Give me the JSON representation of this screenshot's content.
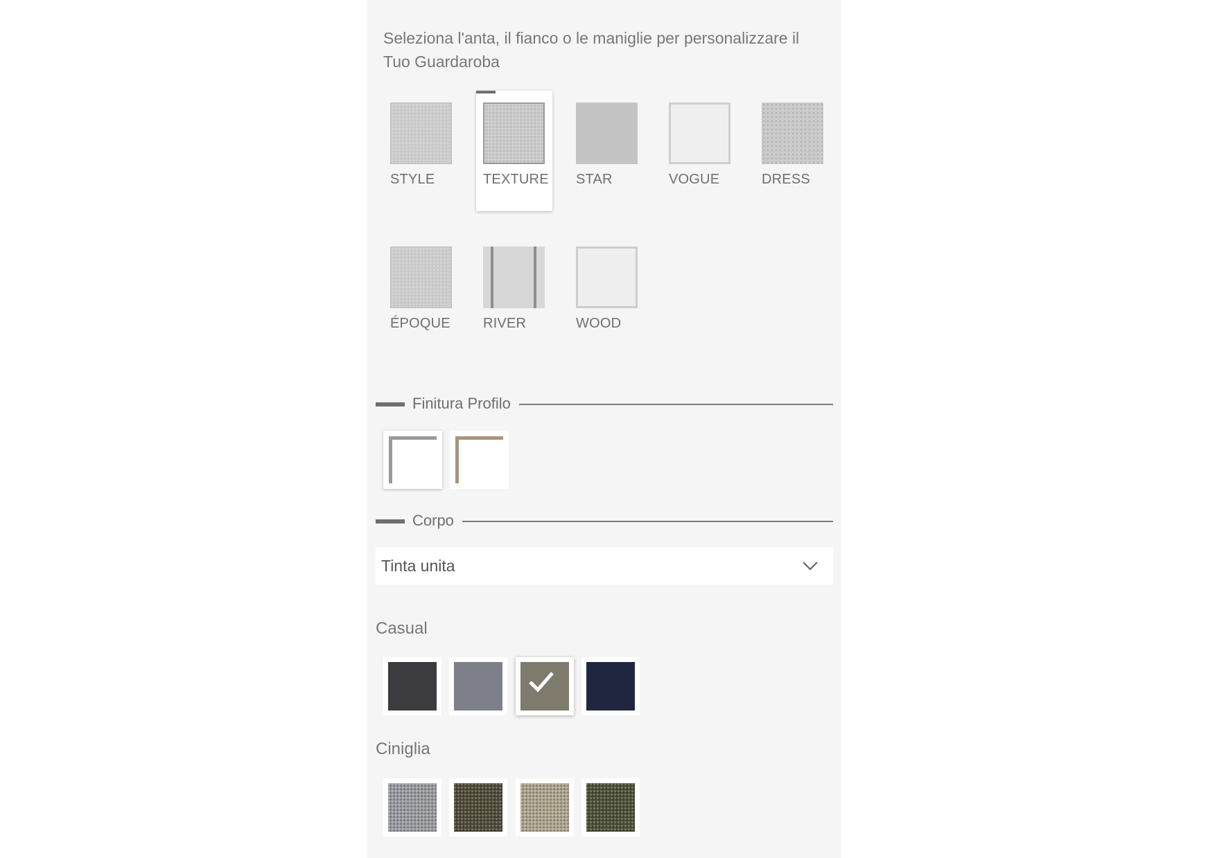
{
  "intro_text": "Seleziona l'anta, il fianco o le maniglie per personalizzare il Tuo Guardaroba",
  "door_styles": [
    {
      "label": "STYLE",
      "selected": false
    },
    {
      "label": "TEXTURE",
      "selected": true
    },
    {
      "label": "STAR",
      "selected": false
    },
    {
      "label": "VOGUE",
      "selected": false
    },
    {
      "label": "DRESS",
      "selected": false
    },
    {
      "label": "ÉPOQUE",
      "selected": false
    },
    {
      "label": "RIVER",
      "selected": false
    },
    {
      "label": "WOOD",
      "selected": false
    }
  ],
  "profile_section": {
    "title": "Finitura Profilo",
    "options": [
      {
        "name": "silver",
        "color": "#9a9a9a",
        "selected": true
      },
      {
        "name": "bronze",
        "color": "#a8957a",
        "selected": false
      }
    ]
  },
  "body_section": {
    "title": "Corpo",
    "select_value": "Tinta unita"
  },
  "groups": [
    {
      "title": "Casual",
      "swatches": [
        {
          "color": "#3c3c40",
          "selected": false
        },
        {
          "color": "#7d8088",
          "selected": false
        },
        {
          "color": "#7f7b6c",
          "selected": true
        },
        {
          "color": "#1f2740",
          "selected": false
        }
      ]
    },
    {
      "title": "Ciniglia",
      "swatches": [
        {
          "color": "#9a9ca1",
          "selected": false
        },
        {
          "color": "#4f4a38",
          "selected": false
        },
        {
          "color": "#b0a68e",
          "selected": false
        },
        {
          "color": "#4c5036",
          "selected": false
        }
      ]
    }
  ]
}
